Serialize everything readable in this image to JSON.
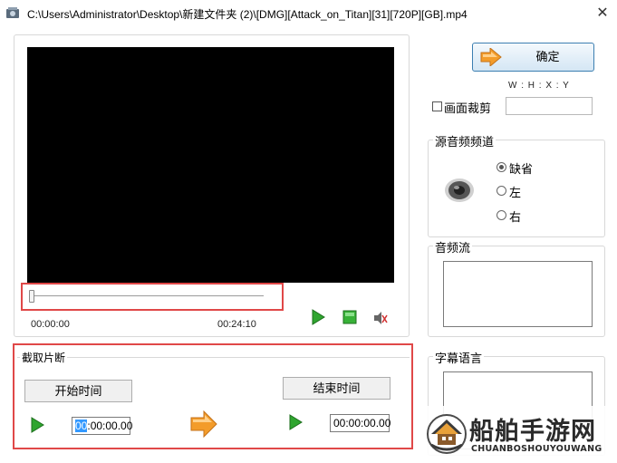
{
  "window": {
    "title": "C:\\Users\\Administrator\\Desktop\\新建文件夹 (2)\\[DMG][Attack_on_Titan][31][720P][GB].mp4",
    "close_glyph": "✕"
  },
  "player": {
    "current_time": "00:00:00",
    "total_time": "00:24:10",
    "seek_progress": 0.0
  },
  "confirm": {
    "label": "确定"
  },
  "crop": {
    "whxy_label": "W : H : X : Y",
    "checkbox_label": "画面裁剪",
    "checked": false,
    "value": ""
  },
  "audio_channel": {
    "title": "源音频频道",
    "options": [
      "缺省",
      "左",
      "右"
    ],
    "selected": "缺省"
  },
  "audio_stream": {
    "title": "音频流"
  },
  "subtitle": {
    "title": "字幕语言"
  },
  "clip": {
    "title": "截取片断",
    "start_label": "开始时间",
    "end_label": "结束时间",
    "start_time_sel": "00",
    "start_time_rest": ":00:00.00",
    "end_time": "00:00:00.00"
  },
  "watermark": {
    "text": "船舶手游网",
    "subtext": "CHUANBOSHOUYOUWANG"
  },
  "colors": {
    "accent_red": "#e04848",
    "confirm_border": "#3c7fb1",
    "video_bg": "#000000"
  }
}
